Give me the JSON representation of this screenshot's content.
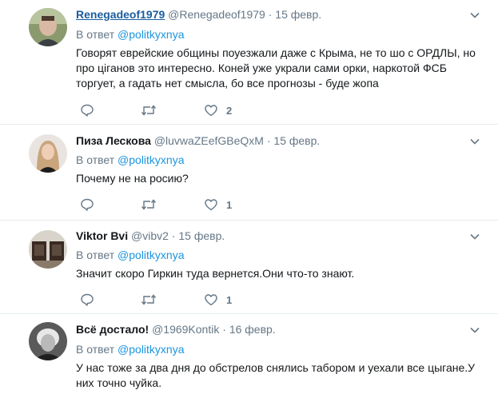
{
  "reply_prefix": "В ответ",
  "tweets": [
    {
      "name": "Renegadeof1979",
      "handle": "@Renegadeof1979",
      "date": "15 февр.",
      "reply_handle": "@politkyxnya",
      "text": "Говорят еврейские общины поуезжали даже с Крыма, не то шо с ОРДЛЫ, но про ціганов это интересно. Коней уже украли сами орки, наркотой ФСБ торгует, а гадать нет смысла, бо все прогнозы - буде жопа",
      "likes": "2"
    },
    {
      "name": "Пиза Лескова",
      "handle": "@luvwaZEefGBeQxM",
      "date": "15 февр.",
      "reply_handle": "@politkyxnya",
      "text": "Почему не на росию?",
      "likes": "1"
    },
    {
      "name": "Viktor Bvi",
      "handle": "@vibv2",
      "date": "15 февр.",
      "reply_handle": "@politkyxnya",
      "text": "Значит скоро Гиркин туда вернется.Они что-то знают.",
      "likes": "1"
    },
    {
      "name": "Всё достало!",
      "handle": "@1969Kontik",
      "date": "16 февр.",
      "reply_handle": "@politkyxnya",
      "text": "У нас тоже за два дня до обстрелов снялись табором и уехали все цыгане.У них точно чуйка."
    }
  ],
  "colors": {
    "accent": "#1b95e0",
    "secondary_text": "#657786",
    "primary_text": "#14171a",
    "divider": "#e6ecf0"
  }
}
